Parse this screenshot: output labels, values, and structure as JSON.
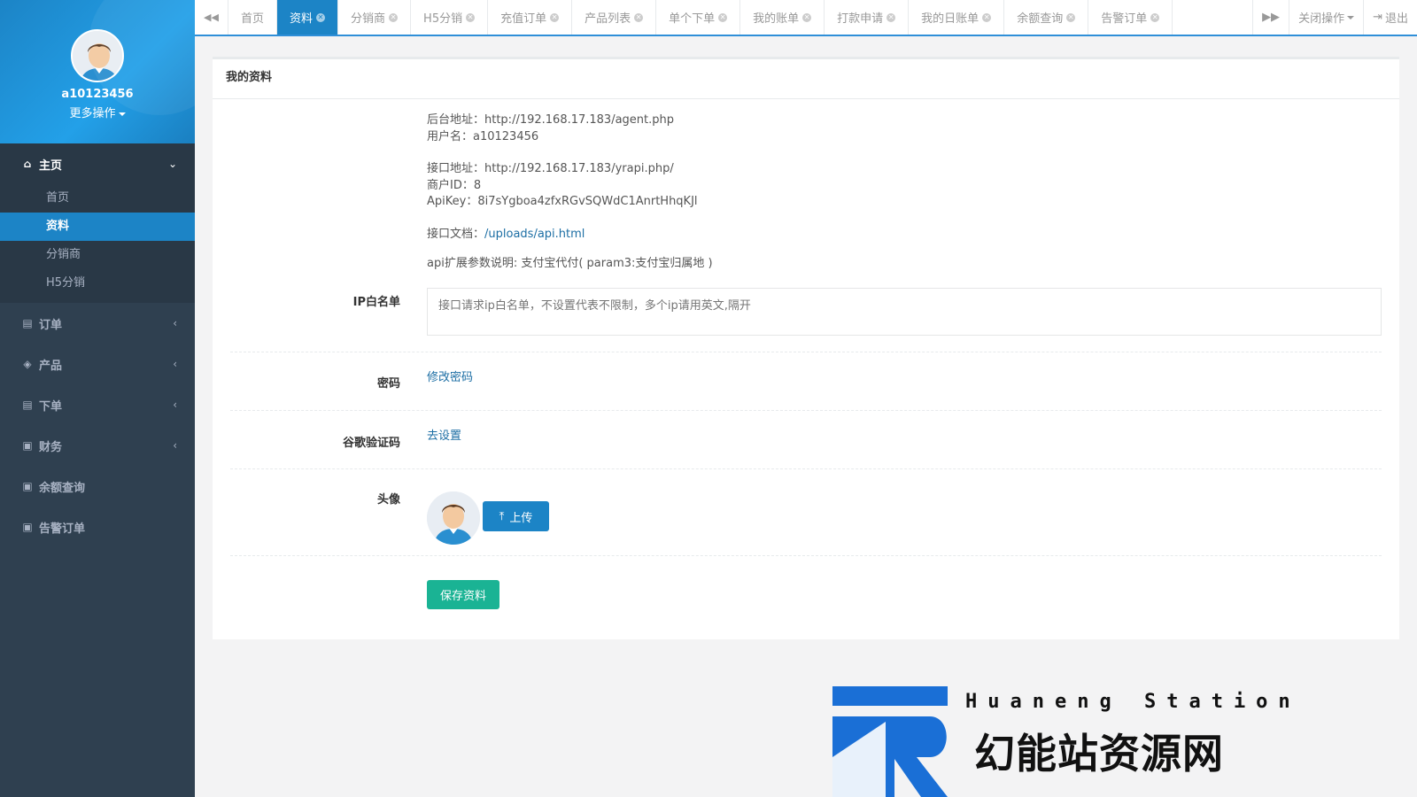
{
  "sidebar": {
    "username": "a10123456",
    "more_ops": "更多操作",
    "menu": {
      "home": {
        "label": "主页",
        "items": [
          "首页",
          "资料",
          "分销商",
          "H5分销"
        ]
      },
      "orders": "订单",
      "products": "产品",
      "place_order": "下单",
      "finance": "财务",
      "balance": "余额查询",
      "alert_orders": "告警订单"
    }
  },
  "tabbar": {
    "tabs": [
      "首页",
      "资料",
      "分销商",
      "H5分销",
      "充值订单",
      "产品列表",
      "单个下单",
      "我的账单",
      "打款申请",
      "我的日账单",
      "余额查询",
      "告警订单"
    ],
    "active_tab": "资料",
    "close_ops": "关闭操作",
    "logout": "退出"
  },
  "main": {
    "panel_title": "我的资料",
    "info": {
      "backend_addr": "后台地址：http://192.168.17.183/agent.php",
      "username_line": "用户名：a10123456",
      "api_addr": "接口地址：http://192.168.17.183/yrapi.php/",
      "merchant_id": "商户ID：8",
      "api_key": "ApiKey：8i7sYgboa4zfxRGvSQWdC1AnrtHhqKJl",
      "doc_label": "接口文档：",
      "doc_link": "/uploads/api.html",
      "ext_params": "api扩展参数说明: 支付宝代付( param3:支付宝归属地 )"
    },
    "ip_whitelist": {
      "label": "IP白名单",
      "placeholder": "接口请求ip白名单，不设置代表不限制，多个ip请用英文,隔开"
    },
    "password": {
      "label": "密码",
      "link": "修改密码"
    },
    "google_auth": {
      "label": "谷歌验证码",
      "link": "去设置"
    },
    "avatar": {
      "label": "头像",
      "upload": "上传"
    },
    "save": "保存资料"
  },
  "brand": {
    "sub": "Huaneng Station",
    "main": "幻能站资源网",
    "colors": {
      "primary": "#1a6fd6",
      "text": "#111111"
    }
  },
  "colors": {
    "sidebar": "#2f4050",
    "accent": "#1c84c6",
    "save": "#1ab394"
  }
}
